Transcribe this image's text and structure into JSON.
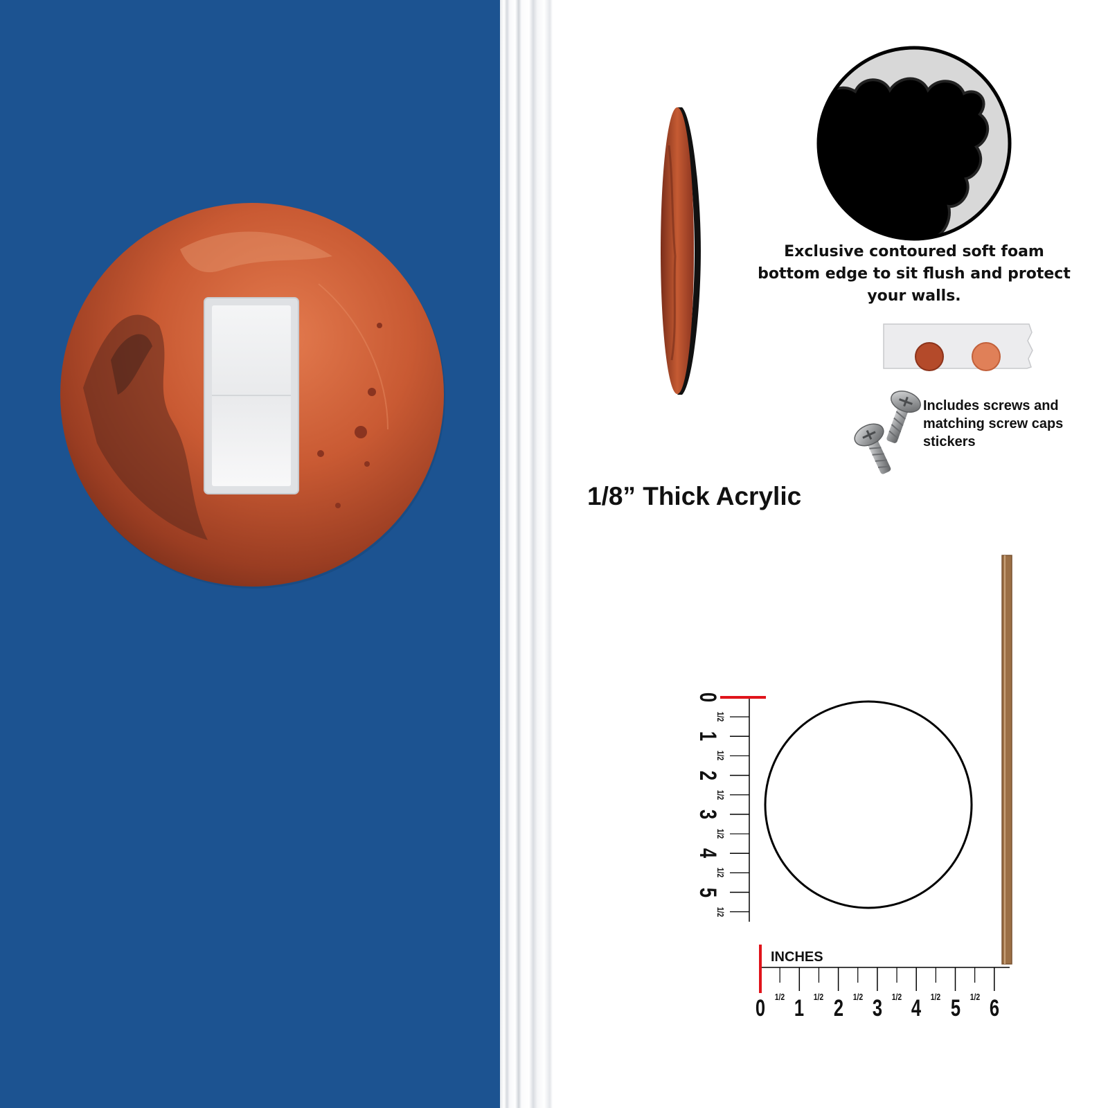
{
  "foam_caption": {
    "line1": "Exclusive contoured soft foam",
    "line2": "bottom edge to sit flush and protect",
    "line3": "your walls."
  },
  "screws_caption": {
    "line1": "Includes screws and",
    "line2": "matching screw caps",
    "line3": "stickers"
  },
  "thickness_label": "1/8” Thick Acrylic",
  "ruler": {
    "unit_label": "INCHES",
    "horizontal_numbers": [
      "0",
      "1",
      "2",
      "3",
      "4",
      "5",
      "6"
    ],
    "vertical_numbers": [
      "0",
      "1",
      "2",
      "3",
      "4",
      "5"
    ],
    "half_label": "1/2"
  },
  "colors": {
    "wall": "#1c5391",
    "planet": "#c4532e",
    "ruler_zero_marker": "#e0141b",
    "profile_edge": "#9b6f45"
  }
}
